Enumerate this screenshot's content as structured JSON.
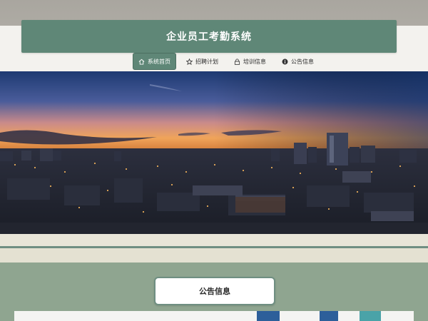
{
  "site": {
    "title": "企业员工考勤系统"
  },
  "nav": {
    "items": [
      {
        "label": "系统首页",
        "icon": "home-icon",
        "active": true
      },
      {
        "label": "招聘计划",
        "icon": "star-icon",
        "active": false
      },
      {
        "label": "培训信息",
        "icon": "lock-icon",
        "active": false
      },
      {
        "label": "公告信息",
        "icon": "info-icon",
        "active": false
      }
    ]
  },
  "carousel": {
    "slide_count": 2,
    "active_index": 1
  },
  "notice": {
    "title": "公告信息"
  },
  "colors": {
    "primary": "#5f8777",
    "section_bg": "#8fa590",
    "page_bg": "#f3f2ee"
  }
}
